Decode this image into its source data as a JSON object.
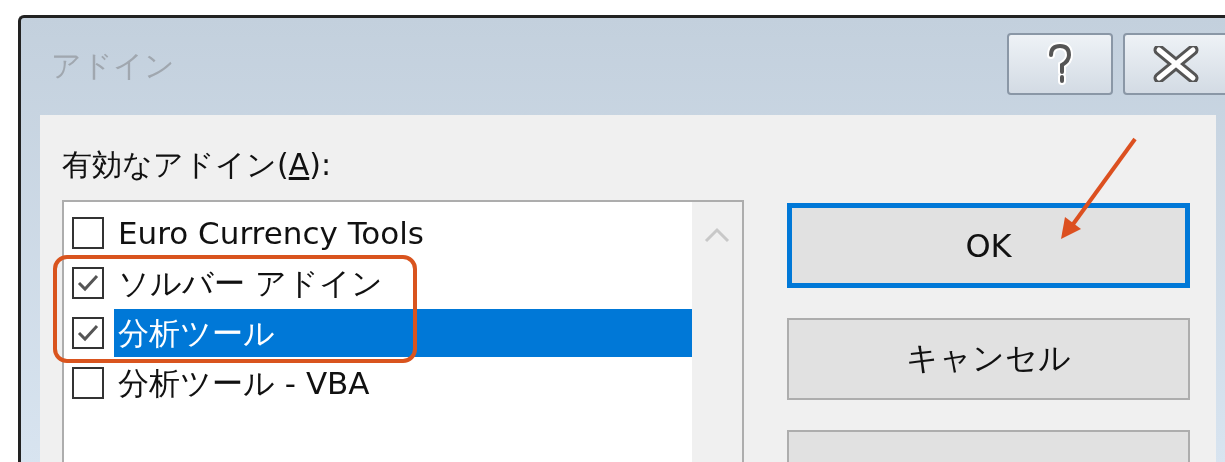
{
  "window": {
    "title": "アドイン"
  },
  "addins_label": {
    "text_before": "有効なアドイン(",
    "access_key": "A",
    "text_after": "):"
  },
  "addins": [
    {
      "name": "Euro Currency Tools",
      "checked": false,
      "selected": false
    },
    {
      "name": "ソルバー アドイン",
      "checked": true,
      "selected": false
    },
    {
      "name": "分析ツール",
      "checked": true,
      "selected": true
    },
    {
      "name": "分析ツール - VBA",
      "checked": false,
      "selected": false
    }
  ],
  "buttons": [
    {
      "label": "OK",
      "selected": true
    },
    {
      "label": "キャンセル",
      "selected": false
    },
    {
      "selected": false
    }
  ]
}
